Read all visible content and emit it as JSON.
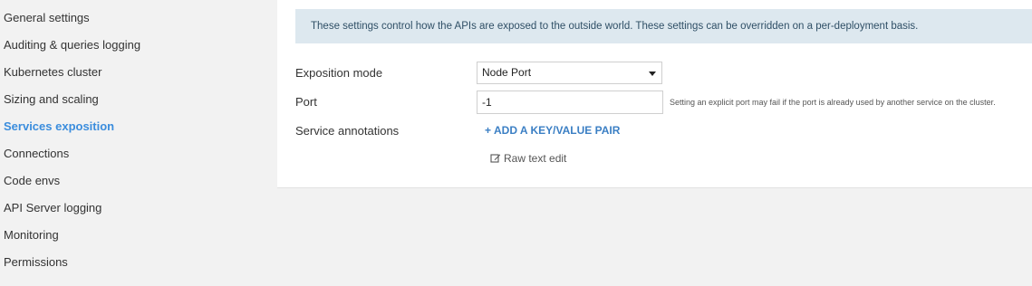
{
  "sidebar": {
    "items": [
      {
        "label": "General settings"
      },
      {
        "label": "Auditing & queries logging"
      },
      {
        "label": "Kubernetes cluster"
      },
      {
        "label": "Sizing and scaling"
      },
      {
        "label": "Services exposition"
      },
      {
        "label": "Connections"
      },
      {
        "label": "Code envs"
      },
      {
        "label": "API Server logging"
      },
      {
        "label": "Monitoring"
      },
      {
        "label": "Permissions"
      }
    ],
    "active_item": "Services exposition"
  },
  "panel": {
    "info_text": "These settings control how the APIs are exposed to the outside world. These settings can be overridden on a per-deployment basis.",
    "exposition_mode": {
      "label": "Exposition mode",
      "value": "Node Port"
    },
    "port": {
      "label": "Port",
      "value": "-1",
      "help": "Setting an explicit port may fail if the port is already used by another service on the cluster."
    },
    "service_annotations": {
      "label": "Service annotations",
      "add_label": "ADD A KEY/VALUE PAIR",
      "add_icon": "+",
      "raw_label": "Raw text edit"
    }
  },
  "colors": {
    "accent": "#3b8ddd",
    "info_bg": "#dde8ef",
    "page_bg": "#f2f2f2"
  }
}
